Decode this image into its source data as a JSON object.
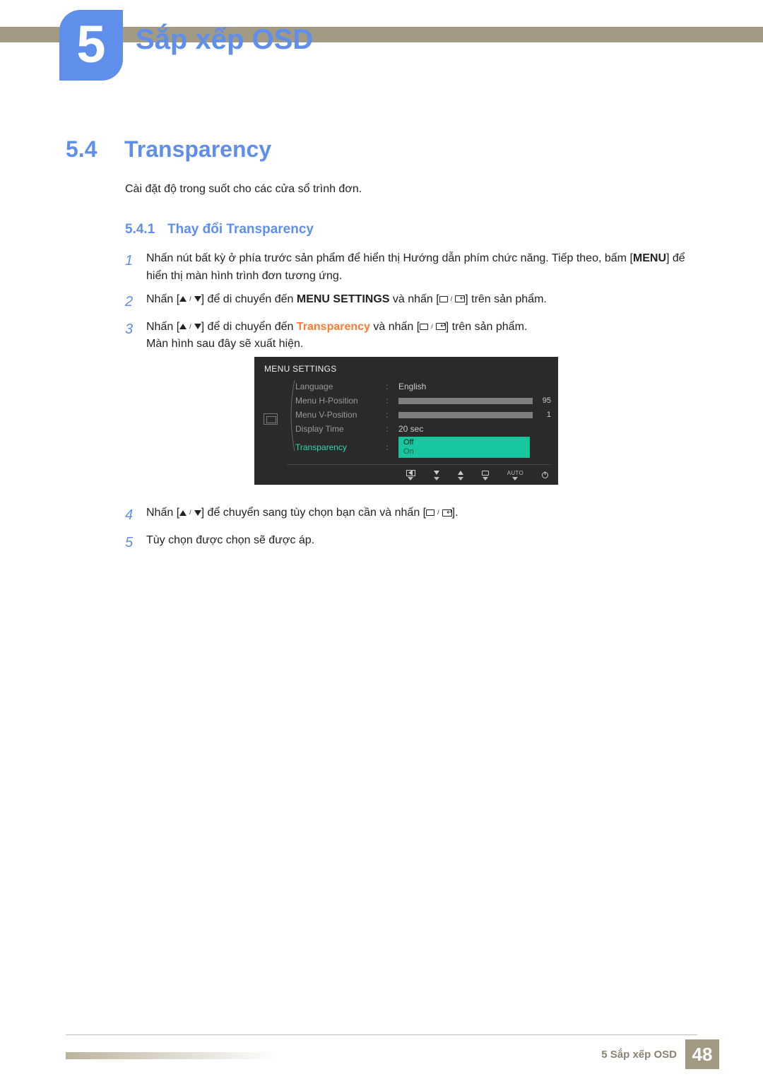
{
  "chapter": {
    "number": "5",
    "title": "Sắp xếp OSD"
  },
  "section": {
    "number": "5.4",
    "title": "Transparency",
    "desc": "Cài đặt độ trong suốt cho các cửa sổ trình đơn."
  },
  "subsection": {
    "number": "5.4.1",
    "title": "Thay đổi Transparency"
  },
  "steps": {
    "s1": {
      "num": "1",
      "a": "Nhấn nút bất kỳ ở phía trước sản phẩm để hiển thị Hướng dẫn phím chức năng. Tiếp theo, bấm [",
      "menu": "MENU",
      "b": "] để hiển thị màn hình trình đơn tương ứng."
    },
    "s2": {
      "num": "2",
      "a": "Nhấn [",
      "b": "] để di chuyển đến ",
      "target": "MENU SETTINGS",
      "c": " và nhấn [",
      "d": "] trên sản phẩm."
    },
    "s3": {
      "num": "3",
      "a": "Nhấn [",
      "b": "] để di chuyển đến ",
      "target": "Transparency",
      "c": " và nhấn [",
      "d": "] trên sản phẩm.",
      "e": "Màn hình sau đây sẽ xuất hiện."
    },
    "s4": {
      "num": "4",
      "a": "Nhấn [",
      "b": "] để chuyển sang tùy chọn bạn cần và nhấn [",
      "c": "]."
    },
    "s5": {
      "num": "5",
      "text": "Tùy chọn được chọn sẽ được áp."
    }
  },
  "osd": {
    "title": "MENU SETTINGS",
    "rows": {
      "language": {
        "label": "Language",
        "value": "English"
      },
      "hpos": {
        "label": "Menu H-Position",
        "value": "95",
        "fill": 95
      },
      "vpos": {
        "label": "Menu V-Position",
        "value": "1",
        "fill": 1
      },
      "dtime": {
        "label": "Display Time",
        "value": "20 sec"
      },
      "trans": {
        "label": "Transparency",
        "opt_off": "Off",
        "opt_on": "On"
      }
    },
    "foot_auto": "AUTO"
  },
  "footer": {
    "text": "5 Sắp xếp OSD",
    "page": "48"
  }
}
